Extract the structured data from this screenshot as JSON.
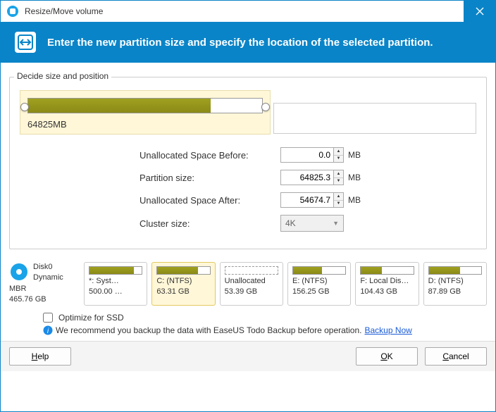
{
  "window": {
    "title": "Resize/Move volume"
  },
  "banner": {
    "text": "Enter the new partition size and specify the location of the selected partition."
  },
  "group": {
    "legend": "Decide size and position",
    "slider_value": "64825MB",
    "fields": {
      "before_label": "Unallocated Space Before:",
      "before_value": "0.0",
      "before_unit": "MB",
      "size_label": "Partition size:",
      "size_value": "64825.3",
      "size_unit": "MB",
      "after_label": "Unallocated Space After:",
      "after_value": "54674.7",
      "after_unit": "MB",
      "cluster_label": "Cluster size:",
      "cluster_value": "4K"
    }
  },
  "disk": {
    "name": "Disk0",
    "type": "Dynamic MBR",
    "size": "465.76 GB",
    "partitions": [
      {
        "label": "*: Syst…",
        "size": "500.00 …",
        "fill": 85,
        "selected": false,
        "unalloc": false
      },
      {
        "label": "C: (NTFS)",
        "size": "63.31 GB",
        "fill": 78,
        "selected": true,
        "unalloc": false
      },
      {
        "label": "Unallocated",
        "size": "53.39 GB",
        "fill": 0,
        "selected": false,
        "unalloc": true
      },
      {
        "label": "E: (NTFS)",
        "size": "156.25 GB",
        "fill": 55,
        "selected": false,
        "unalloc": false
      },
      {
        "label": "F: Local Dis…",
        "size": "104.43 GB",
        "fill": 40,
        "selected": false,
        "unalloc": false
      },
      {
        "label": "D: (NTFS)",
        "size": "87.89 GB",
        "fill": 60,
        "selected": false,
        "unalloc": false
      }
    ]
  },
  "footer": {
    "optimize": "Optimize for SSD",
    "note": "We recommend you backup the data with EaseUS Todo Backup before operation.",
    "link": "Backup Now"
  },
  "buttons": {
    "help": "elp",
    "help_key": "H",
    "ok": "K",
    "ok_key": "O",
    "cancel": "ancel",
    "cancel_key": "C"
  }
}
